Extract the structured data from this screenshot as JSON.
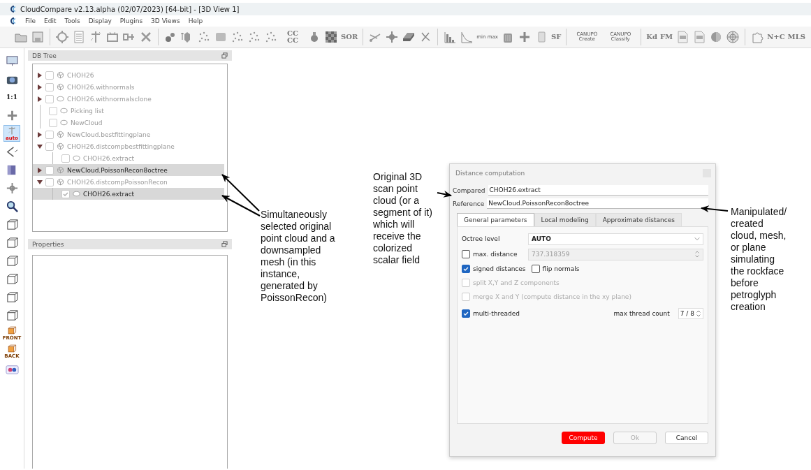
{
  "window": {
    "title": "CloudCompare v2.13.alpha (02/07/2023) [64-bit] - [3D View 1]"
  },
  "menu": [
    "File",
    "Edit",
    "Tools",
    "Display",
    "Plugins",
    "3D Views",
    "Help"
  ],
  "toolbar_labels": [
    "CC CC",
    "SOR",
    "min max",
    "SF",
    "CANUPO Create",
    "CANUPO Classify",
    "Kd",
    "FM",
    "N+C",
    "MLS"
  ],
  "left_toolbar": [
    {
      "selected": false
    },
    {
      "selected": false
    },
    {
      "selected": false,
      "label": "1:1"
    },
    {
      "selected": false
    },
    {
      "selected": true,
      "label": "auto"
    },
    {
      "selected": false
    },
    {
      "selected": false
    },
    {
      "selected": false
    },
    {
      "selected": false
    },
    {
      "selected": false
    },
    {
      "selected": false
    },
    {
      "selected": false
    },
    {
      "selected": false
    },
    {
      "selected": false
    },
    {
      "selected": false
    },
    {
      "selected": false,
      "label": "FRONT"
    },
    {
      "selected": false,
      "label": "BACK"
    },
    {
      "selected": false
    }
  ],
  "db_tree": {
    "title": "DB Tree",
    "items": [
      {
        "name": "CHOH26",
        "kind": "mesh",
        "checked": false,
        "selected": false,
        "enabled": false,
        "expanded": false
      },
      {
        "name": "CHOH26.withnormals",
        "kind": "mesh",
        "checked": false,
        "selected": false,
        "enabled": false,
        "expanded": false
      },
      {
        "name": "CHOH26.withnormalsclone",
        "kind": "cloud",
        "checked": false,
        "selected": false,
        "enabled": false,
        "expanded": false
      },
      {
        "name": "Picking list",
        "kind": "cloud",
        "checked": false,
        "selected": false,
        "enabled": false
      },
      {
        "name": "NewCloud",
        "kind": "cloud",
        "checked": false,
        "selected": false,
        "enabled": false
      },
      {
        "name": "NewCloud.bestfittingplane",
        "kind": "mesh",
        "checked": false,
        "selected": false,
        "enabled": false,
        "expanded": false
      },
      {
        "name": "CHOH26.distcompbestfittingplane",
        "kind": "mesh",
        "checked": false,
        "selected": false,
        "enabled": false,
        "expanded": true,
        "children": [
          {
            "name": "CHOH26.extract",
            "kind": "cloud",
            "checked": false,
            "selected": false,
            "enabled": false
          }
        ]
      },
      {
        "name": "NewCloud.PoissonRecon8octree",
        "kind": "mesh",
        "checked": false,
        "selected": true,
        "enabled": true,
        "expanded": false
      },
      {
        "name": "CHOH26.distcompPoissonRecon",
        "kind": "mesh",
        "checked": false,
        "selected": false,
        "enabled": false,
        "expanded": true,
        "children": [
          {
            "name": "CHOH26.extract",
            "kind": "cloud",
            "checked": true,
            "selected": true,
            "enabled": true
          }
        ]
      }
    ]
  },
  "properties": {
    "title": "Properties"
  },
  "dialog": {
    "title": "Distance computation",
    "compared": {
      "label": "Compared",
      "value": "CHOH26.extract"
    },
    "reference": {
      "label": "Reference",
      "value": "NewCloud.PoissonRecon8octree"
    },
    "tabs": [
      {
        "label": "General parameters",
        "selected": true
      },
      {
        "label": "Local modeling",
        "selected": false
      },
      {
        "label": "Approximate distances",
        "selected": false
      }
    ],
    "octree": {
      "label": "Octree level",
      "value": "AUTO"
    },
    "max_distance": {
      "label": "max. distance",
      "checked": false,
      "value": "737.318359"
    },
    "options": [
      {
        "label": "signed distances",
        "checked": true,
        "disabled": false
      },
      {
        "label": "flip normals",
        "checked": false,
        "disabled": false
      }
    ],
    "components": [
      {
        "label": "split X,Y and Z components",
        "checked": false,
        "disabled": true
      },
      {
        "label": "merge X and Y (compute distance in the xy plane)",
        "checked": false,
        "disabled": true
      }
    ],
    "multi_threaded": {
      "label": "multi-threaded",
      "checked": true,
      "disabled": false
    },
    "thread_count": {
      "label": "max thread count",
      "value": "7 / 8"
    },
    "buttons": [
      {
        "label": "Compute",
        "kind": "primary",
        "disabled": false
      },
      {
        "label": "Ok",
        "kind": "normal",
        "disabled": true
      },
      {
        "label": "Cancel",
        "kind": "normal",
        "disabled": false
      }
    ]
  },
  "annotations": [
    {
      "text": "Simultaneously selected original point cloud and a downsampled mesh (in this instance, generated by PoissonRecon)"
    },
    {
      "text": "Original 3D scan point cloud (or a segment of it) which will receive the colorized scalar field"
    },
    {
      "text": "Manipulated/ created cloud, mesh, or plane simulating the rockface before petroglyph creation"
    }
  ]
}
